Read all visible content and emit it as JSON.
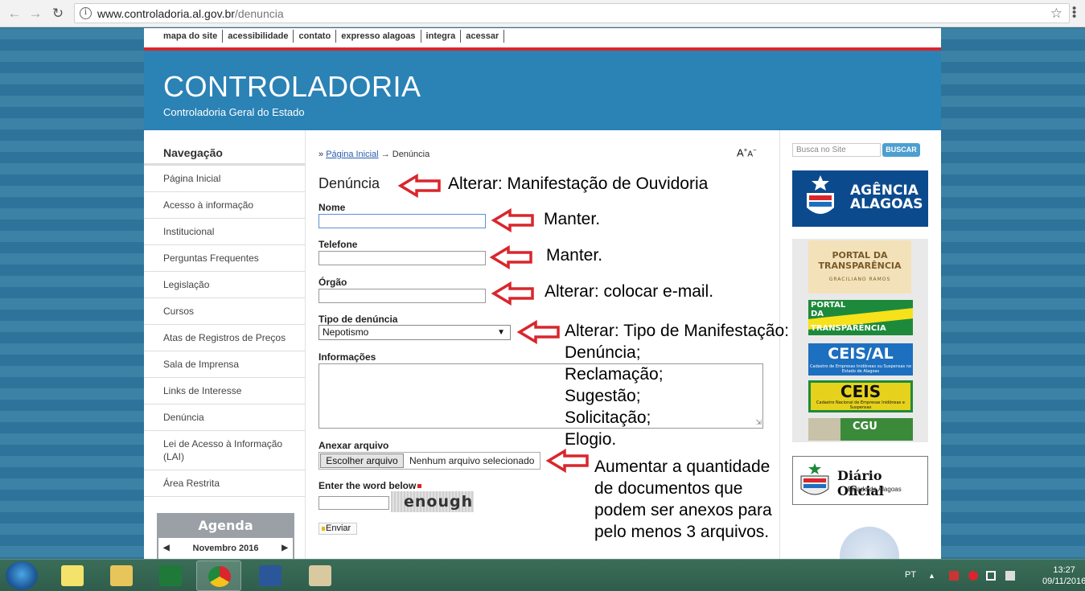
{
  "browser": {
    "url_host": "www.controladoria.al.gov.br",
    "url_path": "/denuncia"
  },
  "topnav": [
    "mapa do site",
    "acessibilidade",
    "contato",
    "expresso alagoas",
    "integra",
    "acessar"
  ],
  "banner": {
    "title": "CONTROLADORIA",
    "subtitle": "Controladoria Geral do Estado"
  },
  "sidebar": {
    "title": "Navegação",
    "items": [
      "Página Inicial",
      "Acesso à informação",
      "Institucional",
      "Perguntas Frequentes",
      "Legislação",
      "Cursos",
      "Atas de Registros de Preços",
      "Sala de Imprensa",
      "Links de Interesse",
      "Denúncia",
      "Lei de Acesso à Informação (LAI)",
      "Área Restrita"
    ],
    "agenda": {
      "title": "Agenda",
      "month": "Novembro 2016"
    }
  },
  "main": {
    "breadcrumb_prefix": "»",
    "breadcrumb_home": "Página Inicial",
    "breadcrumb_sep": "→",
    "breadcrumb_current": "Denúncia",
    "fontsize_big": "A",
    "fontsize_small": "A",
    "heading": "Denúncia",
    "form": {
      "nome_label": "Nome",
      "telefone_label": "Telefone",
      "orgao_label": "Órgão",
      "tipo_label": "Tipo de denúncia",
      "tipo_selected": "Nepotismo",
      "informacoes_label": "Informações",
      "anexar_label": "Anexar arquivo",
      "file_button": "Escolher arquivo",
      "file_status": "Nenhum arquivo selecionado",
      "captcha_label": "Enter the word below",
      "captcha_word": "enough",
      "submit": "Enviar"
    }
  },
  "right": {
    "search_placeholder": "Busca no Site",
    "search_button": "BUSCAR",
    "agencia": [
      "AGÊNCIA",
      "ALAGOAS"
    ],
    "portal_transparencia": [
      "PORTAL DA",
      "TRANSPARÊNCIA",
      "GRACILIANO RAMOS"
    ],
    "portal_da_transparencia": [
      "PORTAL",
      "DA",
      "TRANSPARÊNCIA"
    ],
    "ceis_al": "CEIS/AL",
    "ceis_al_sub": "Cadastro de Empresas Inidôneas ou Suspensas no Estado de Alagoas",
    "ceis": "CEIS",
    "ceis_sub": "Cadastro Nacional de Empresas Inidôneas e Suspensas",
    "cgu": "CGU",
    "diario_title": "Diário Oficial",
    "diario_sub": "Estado de Alagoas"
  },
  "annotations": {
    "a1": "Alterar: Manifestação de Ouvidoria",
    "a2": "Manter.",
    "a3": "Manter.",
    "a4": "Alterar: colocar e-mail.",
    "a5_lines": [
      "Alterar: Tipo de Manifestação:",
      "Denúncia;",
      "Reclamação;",
      "Sugestão;",
      "Solicitação;",
      "Elogio."
    ],
    "a6_lines": [
      "Aumentar a quantidade",
      "de documentos que",
      "podem ser anexos para",
      "pelo menos 3 arquivos."
    ],
    "arrow_color": "#d9262c"
  },
  "taskbar": {
    "lang": "PT",
    "time": "13:27",
    "date": "09/11/2016"
  }
}
